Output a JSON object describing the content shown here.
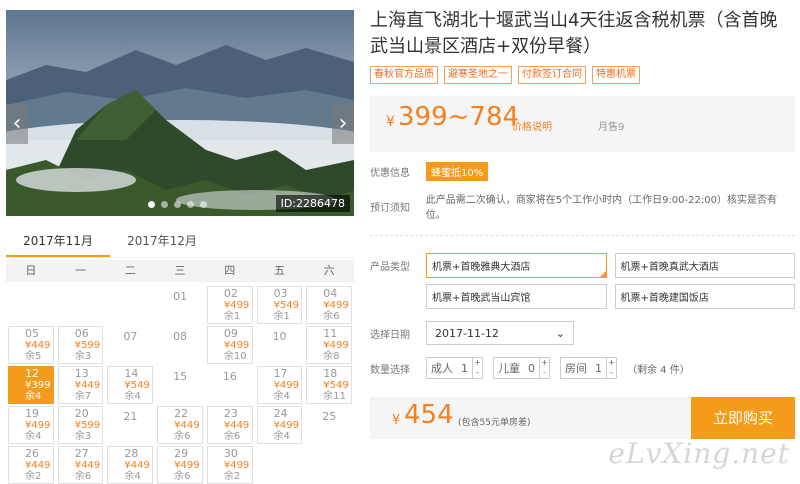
{
  "gallery": {
    "id_label": "ID:2286478",
    "prev_icon": "‹",
    "next_icon": "›"
  },
  "month_tabs": [
    "2017年11月",
    "2017年12月"
  ],
  "weekdays": [
    "日",
    "一",
    "二",
    "三",
    "四",
    "五",
    "六"
  ],
  "calendar": [
    {
      "d": "",
      "p": "",
      "r": ""
    },
    {
      "d": "",
      "p": "",
      "r": ""
    },
    {
      "d": "",
      "p": "",
      "r": ""
    },
    {
      "d": "01",
      "p": "",
      "r": ""
    },
    {
      "d": "02",
      "p": "¥499",
      "r": "余1"
    },
    {
      "d": "03",
      "p": "¥549",
      "r": "余1"
    },
    {
      "d": "04",
      "p": "¥499",
      "r": "余6"
    },
    {
      "d": "05",
      "p": "¥449",
      "r": "余5"
    },
    {
      "d": "06",
      "p": "¥599",
      "r": "余3"
    },
    {
      "d": "07",
      "p": "",
      "r": ""
    },
    {
      "d": "08",
      "p": "",
      "r": ""
    },
    {
      "d": "09",
      "p": "¥499",
      "r": "余10"
    },
    {
      "d": "10",
      "p": "",
      "r": ""
    },
    {
      "d": "11",
      "p": "¥499",
      "r": "余8"
    },
    {
      "d": "12",
      "p": "¥399",
      "r": "余4",
      "sel": true
    },
    {
      "d": "13",
      "p": "¥449",
      "r": "余7"
    },
    {
      "d": "14",
      "p": "¥549",
      "r": "余4"
    },
    {
      "d": "15",
      "p": "",
      "r": ""
    },
    {
      "d": "16",
      "p": "",
      "r": ""
    },
    {
      "d": "17",
      "p": "¥499",
      "r": "余4"
    },
    {
      "d": "18",
      "p": "¥549",
      "r": "余11"
    },
    {
      "d": "19",
      "p": "¥499",
      "r": "余4"
    },
    {
      "d": "20",
      "p": "¥599",
      "r": "余3"
    },
    {
      "d": "21",
      "p": "",
      "r": ""
    },
    {
      "d": "22",
      "p": "¥449",
      "r": "余6"
    },
    {
      "d": "23",
      "p": "¥449",
      "r": "余6"
    },
    {
      "d": "24",
      "p": "¥499",
      "r": "余4"
    },
    {
      "d": "25",
      "p": "",
      "r": ""
    },
    {
      "d": "26",
      "p": "¥449",
      "r": "余2"
    },
    {
      "d": "27",
      "p": "¥449",
      "r": "余6"
    },
    {
      "d": "28",
      "p": "¥449",
      "r": "余4"
    },
    {
      "d": "29",
      "p": "¥499",
      "r": "余6"
    },
    {
      "d": "30",
      "p": "¥499",
      "r": "余2"
    }
  ],
  "product": {
    "title": "上海直飞湖北十堰武当山4天往返含税机票（含首晚武当山景区酒店+双份早餐）",
    "tags": [
      "春秋官方品质",
      "避寒圣地之一",
      "付款签订合同",
      "特惠机票"
    ],
    "price_symbol": "¥",
    "price_range": "399~784",
    "price_desc": "价格说明",
    "monthly_sold": "月售9",
    "promo_label": "优惠信息",
    "promo_badge": "蜂蜜抵10%",
    "notice_label": "预订须知",
    "notice_text": "此产品需二次确认，商家将在5个工作小时内（工作日9:00-22:00）核实是否有位。"
  },
  "type_label": "产品类型",
  "types": [
    "机票+首晚雅典大酒店",
    "机票+首晚真武大酒店",
    "机票+首晚武当山宾馆",
    "机票+首晚建国饭店"
  ],
  "date_label": "选择日期",
  "date_value": "2017-11-12",
  "qty_label": "数量选择",
  "qty": [
    {
      "label": "成人",
      "value": "1"
    },
    {
      "label": "儿童",
      "value": "0"
    },
    {
      "label": "房间",
      "value": "1"
    }
  ],
  "remain": "（剩余 4 件）",
  "total_symbol": "¥",
  "total": "454",
  "total_note": "(包含55元单房差)",
  "buy_label": "立即购买",
  "watermark": "eLvXing.net"
}
